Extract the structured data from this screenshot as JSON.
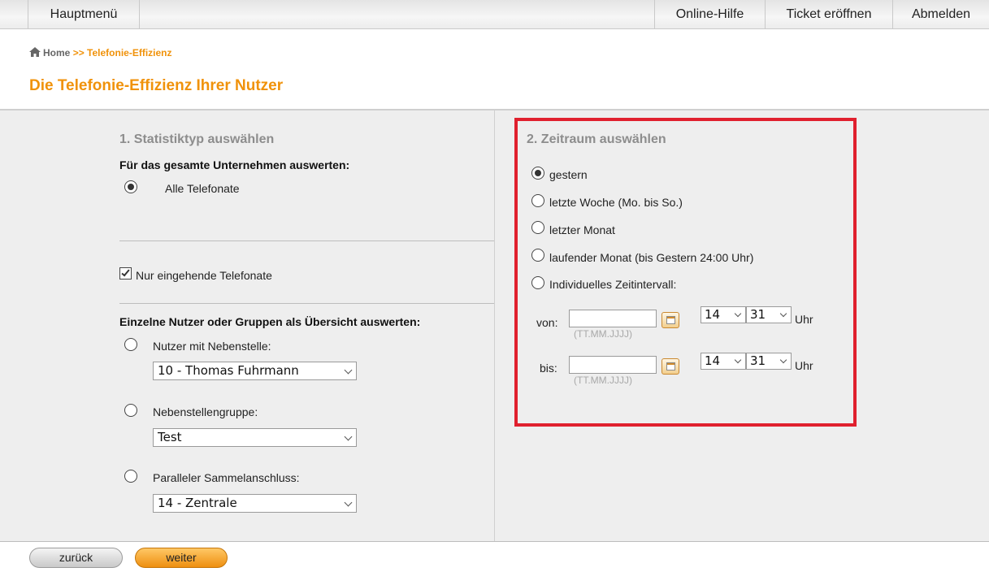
{
  "topbar": {
    "main_menu": "Hauptmenü",
    "help": "Online-Hilfe",
    "ticket": "Ticket eröffnen",
    "logout": "Abmelden"
  },
  "breadcrumb": {
    "home": "Home",
    "separator": ">>",
    "current": "Telefonie-Effizienz"
  },
  "page_title": "Die Telefonie-Effizienz Ihrer Nutzer",
  "left": {
    "section_title": "1. Statistiktyp auswählen",
    "company_heading": "Für das gesamte Unternehmen auswerten:",
    "all_calls_label": "Alle Telefonate",
    "all_calls_selected": true,
    "incoming_only_label": "Nur eingehende Telefonate",
    "incoming_only_checked": true,
    "individual_heading": "Einzelne Nutzer oder Gruppen als Übersicht auswerten:",
    "options": [
      {
        "label": "Nutzer mit Nebenstelle:",
        "selected": false,
        "value": "10 - Thomas Fuhrmann"
      },
      {
        "label": "Nebenstellengruppe:",
        "selected": false,
        "value": "Test"
      },
      {
        "label": "Paralleler Sammelanschluss:",
        "selected": false,
        "value": "14 - Zentrale"
      }
    ]
  },
  "right": {
    "section_title": "2. Zeitraum auswählen",
    "periods": [
      {
        "label": "gestern",
        "selected": true
      },
      {
        "label": "letzte Woche (Mo. bis So.)",
        "selected": false
      },
      {
        "label": "letzter Monat",
        "selected": false
      },
      {
        "label": "laufender Monat (bis Gestern 24:00 Uhr)",
        "selected": false
      },
      {
        "label": "Individuelles Zeitintervall:",
        "selected": false
      }
    ],
    "from": {
      "label": "von:",
      "value": "",
      "hint": "(TT.MM.JJJJ)",
      "hour": "14",
      "minute": "31",
      "unit": "Uhr"
    },
    "to": {
      "label": "bis:",
      "value": "",
      "hint": "(TT.MM.JJJJ)",
      "hour": "14",
      "minute": "31",
      "unit": "Uhr"
    }
  },
  "footer": {
    "back": "zurück",
    "next": "weiter"
  },
  "colors": {
    "accent": "#f0920a",
    "highlight": "#e0202e"
  }
}
